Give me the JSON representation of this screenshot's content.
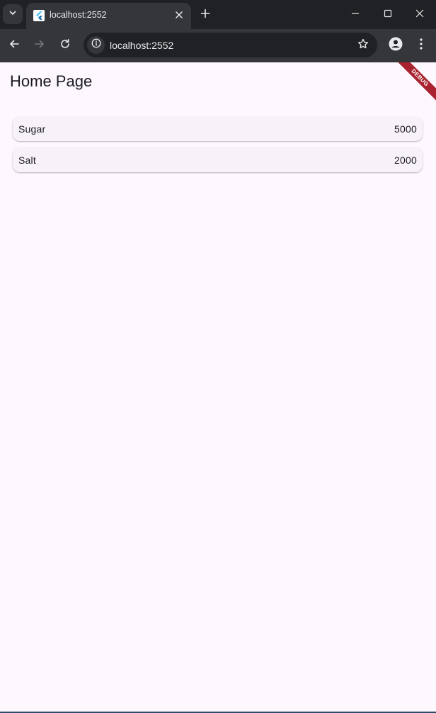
{
  "browser": {
    "tab": {
      "title": "localhost:2552",
      "favicon": "flutter-logo-icon"
    },
    "address_bar": {
      "url": "localhost:2552"
    },
    "icons": {
      "tab_search": "chevron-down-icon",
      "tab_close": "close-icon",
      "new_tab": "plus-icon",
      "minimize": "minimize-icon",
      "maximize": "maximize-icon",
      "close": "close-icon",
      "back": "arrow-left-icon",
      "forward": "arrow-right-icon",
      "reload": "reload-icon",
      "site_info": "info-icon",
      "bookmark": "star-icon",
      "profile": "person-icon",
      "menu": "more-vertical-icon"
    },
    "colors": {
      "frame": "#202124",
      "toolbar": "#35363a",
      "text": "#e8eaed"
    }
  },
  "app": {
    "title": "Home Page",
    "debug_banner": "DEBUG",
    "items": [
      {
        "name": "Sugar",
        "quantity": "5000"
      },
      {
        "name": "Salt",
        "quantity": "2000"
      }
    ],
    "colors": {
      "background": "#fdf7fe",
      "card": "#f7f2f8",
      "text": "#1d1b20",
      "debug_ribbon": "#a8232f"
    }
  }
}
